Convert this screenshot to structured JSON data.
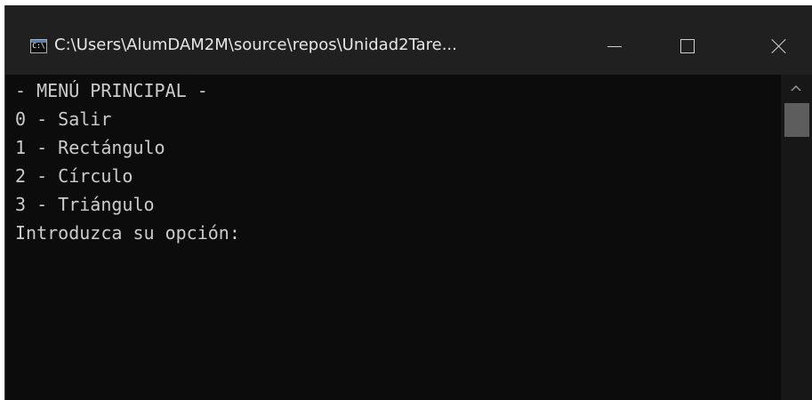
{
  "window": {
    "icon_text": "C:\\",
    "title": "C:\\Users\\AlumDAM2M\\source\\repos\\Unidad2Tare..."
  },
  "icons": {
    "app": "console-app-icon",
    "minimize": "minimize-icon",
    "maximize": "maximize-icon",
    "close": "close-icon",
    "scroll_up": "chevron-up-icon"
  },
  "console": {
    "lines": [
      "- MENÚ PRINCIPAL -",
      "0 - Salir",
      "1 - Rectángulo",
      "2 - Círculo",
      "3 - Triángulo",
      "Introduzca su opción:"
    ]
  },
  "colors": {
    "titlebar_bg": "#202020",
    "console_bg": "#0c0c0c",
    "console_text": "#cccccc",
    "scrollbar_thumb": "#5d5d5d"
  }
}
